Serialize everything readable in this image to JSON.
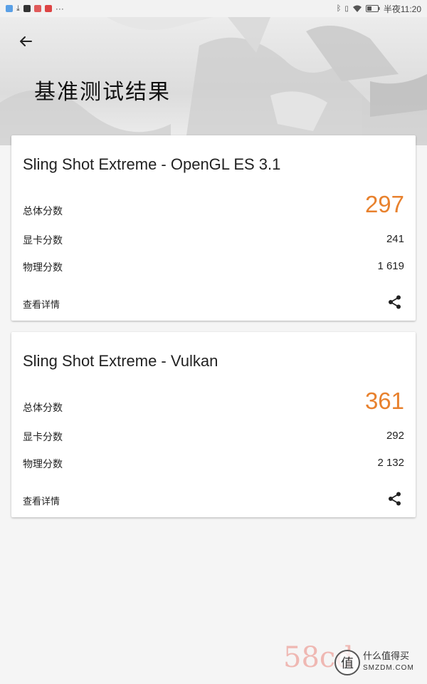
{
  "status_bar": {
    "time_text": "半夜11:20",
    "more_dots": "···"
  },
  "header": {
    "title": "基准测试结果"
  },
  "results": [
    {
      "title": "Sling Shot Extreme - OpenGL ES 3.1",
      "total_label": "总体分数",
      "total_value": "297",
      "graphics_label": "显卡分数",
      "graphics_value": "241",
      "physics_label": "物理分数",
      "physics_value": "1 619",
      "details_label": "查看详情"
    },
    {
      "title": "Sling Shot Extreme - Vulkan",
      "total_label": "总体分数",
      "total_value": "361",
      "graphics_label": "显卡分数",
      "graphics_value": "292",
      "physics_label": "物理分数",
      "physics_value": "2 132",
      "details_label": "查看详情"
    }
  ],
  "watermark": {
    "site_text": "58cd",
    "badge_char": "值",
    "badge_line1": "什么值得买",
    "badge_line2": "SMZDM.COM"
  },
  "colors": {
    "accent": "#e8812d",
    "background": "#f5f5f5",
    "card": "#ffffff"
  },
  "icons": {
    "back": "arrow-left-icon",
    "share": "share-icon"
  }
}
